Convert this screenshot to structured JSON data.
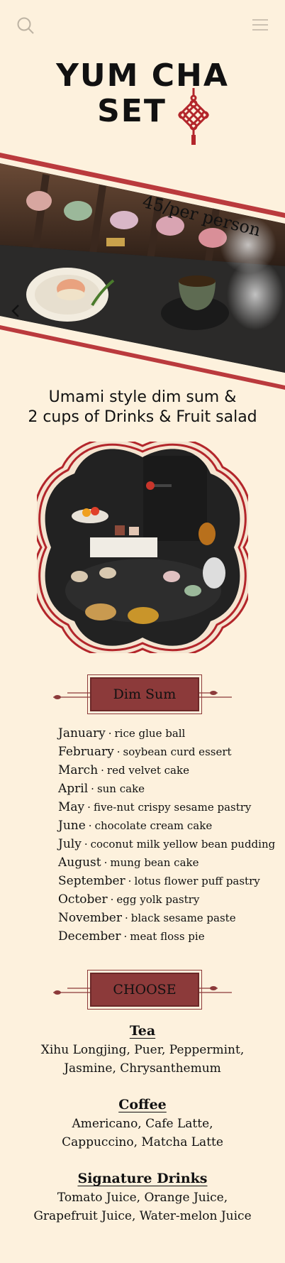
{
  "header": {
    "search_icon": "search-icon",
    "menu_icon": "hamburger-menu-icon"
  },
  "hero": {
    "title_line1": "YUM CHA",
    "title_line2": "SET",
    "price": "45/per person",
    "prev_icon": "chevron-left-icon"
  },
  "description": {
    "line1": "Umami style dim sum  &",
    "line2": "2 cups of Drinks  &  Fruit salad"
  },
  "dimsum": {
    "label": "Dim Sum",
    "items": [
      {
        "month": "January",
        "dish": "rice glue ball"
      },
      {
        "month": "February",
        "dish": "soybean curd essert"
      },
      {
        "month": "March",
        "dish": "red velvet cake"
      },
      {
        "month": "April",
        "dish": "sun cake"
      },
      {
        "month": "May",
        "dish": "five-nut crispy sesame pastry"
      },
      {
        "month": "June",
        "dish": "chocolate cream cake"
      },
      {
        "month": "July",
        "dish": "coconut milk yellow bean pudding"
      },
      {
        "month": "August",
        "dish": "mung bean cake"
      },
      {
        "month": "September",
        "dish": "lotus flower puff pastry"
      },
      {
        "month": "October",
        "dish": "egg yolk pastry"
      },
      {
        "month": "November",
        "dish": "black sesame paste"
      },
      {
        "month": "December",
        "dish": "meat floss pie"
      }
    ],
    "separator": "·"
  },
  "choose": {
    "label": "CHOOSE",
    "groups": [
      {
        "title": "Tea",
        "line1": "Xihu Longjing, Puer, Peppermint,",
        "line2": "Jasmine, Chrysanthemum"
      },
      {
        "title": "Coffee",
        "line1": "Americano, Cafe Latte,",
        "line2": "Cappuccino, Matcha Latte"
      },
      {
        "title": "Signature Drinks",
        "line1": "Tomato Juice, Orange Juice,",
        "line2": "Grapefruit Juice, Water-melon Juice"
      }
    ]
  },
  "colors": {
    "background": "#fdf1dd",
    "accent_red": "#8c3a3a",
    "knot_red": "#b3262b"
  }
}
